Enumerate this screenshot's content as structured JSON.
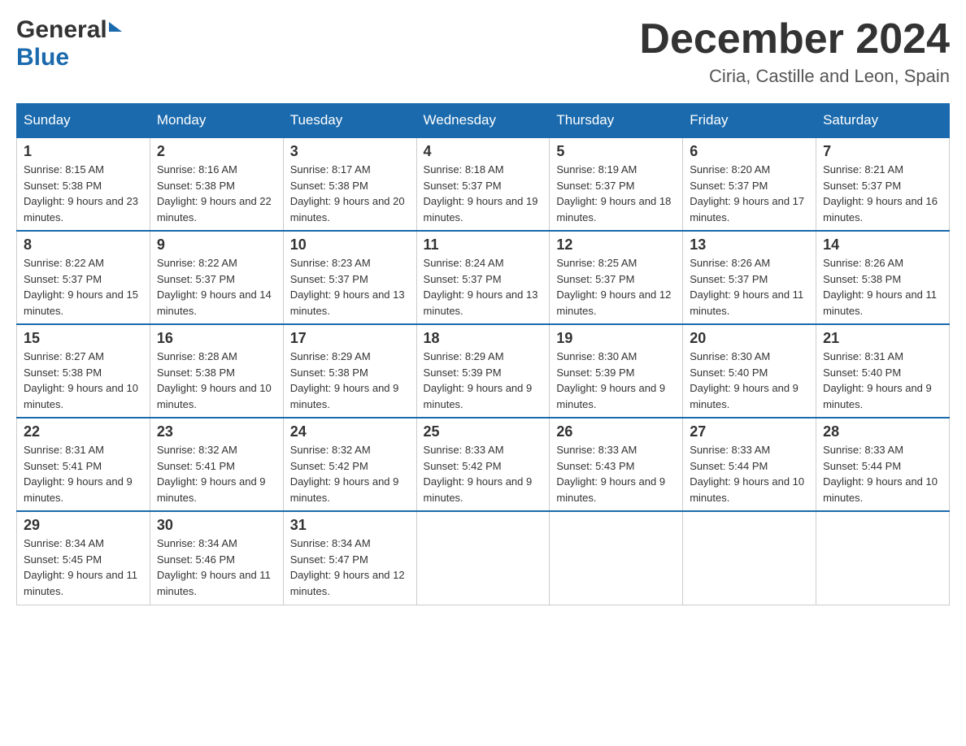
{
  "header": {
    "logo_general": "General",
    "logo_blue": "Blue",
    "month_title": "December 2024",
    "location": "Ciria, Castille and Leon, Spain"
  },
  "days_of_week": [
    "Sunday",
    "Monday",
    "Tuesday",
    "Wednesday",
    "Thursday",
    "Friday",
    "Saturday"
  ],
  "weeks": [
    [
      {
        "day": "1",
        "sunrise": "Sunrise: 8:15 AM",
        "sunset": "Sunset: 5:38 PM",
        "daylight": "Daylight: 9 hours and 23 minutes."
      },
      {
        "day": "2",
        "sunrise": "Sunrise: 8:16 AM",
        "sunset": "Sunset: 5:38 PM",
        "daylight": "Daylight: 9 hours and 22 minutes."
      },
      {
        "day": "3",
        "sunrise": "Sunrise: 8:17 AM",
        "sunset": "Sunset: 5:38 PM",
        "daylight": "Daylight: 9 hours and 20 minutes."
      },
      {
        "day": "4",
        "sunrise": "Sunrise: 8:18 AM",
        "sunset": "Sunset: 5:37 PM",
        "daylight": "Daylight: 9 hours and 19 minutes."
      },
      {
        "day": "5",
        "sunrise": "Sunrise: 8:19 AM",
        "sunset": "Sunset: 5:37 PM",
        "daylight": "Daylight: 9 hours and 18 minutes."
      },
      {
        "day": "6",
        "sunrise": "Sunrise: 8:20 AM",
        "sunset": "Sunset: 5:37 PM",
        "daylight": "Daylight: 9 hours and 17 minutes."
      },
      {
        "day": "7",
        "sunrise": "Sunrise: 8:21 AM",
        "sunset": "Sunset: 5:37 PM",
        "daylight": "Daylight: 9 hours and 16 minutes."
      }
    ],
    [
      {
        "day": "8",
        "sunrise": "Sunrise: 8:22 AM",
        "sunset": "Sunset: 5:37 PM",
        "daylight": "Daylight: 9 hours and 15 minutes."
      },
      {
        "day": "9",
        "sunrise": "Sunrise: 8:22 AM",
        "sunset": "Sunset: 5:37 PM",
        "daylight": "Daylight: 9 hours and 14 minutes."
      },
      {
        "day": "10",
        "sunrise": "Sunrise: 8:23 AM",
        "sunset": "Sunset: 5:37 PM",
        "daylight": "Daylight: 9 hours and 13 minutes."
      },
      {
        "day": "11",
        "sunrise": "Sunrise: 8:24 AM",
        "sunset": "Sunset: 5:37 PM",
        "daylight": "Daylight: 9 hours and 13 minutes."
      },
      {
        "day": "12",
        "sunrise": "Sunrise: 8:25 AM",
        "sunset": "Sunset: 5:37 PM",
        "daylight": "Daylight: 9 hours and 12 minutes."
      },
      {
        "day": "13",
        "sunrise": "Sunrise: 8:26 AM",
        "sunset": "Sunset: 5:37 PM",
        "daylight": "Daylight: 9 hours and 11 minutes."
      },
      {
        "day": "14",
        "sunrise": "Sunrise: 8:26 AM",
        "sunset": "Sunset: 5:38 PM",
        "daylight": "Daylight: 9 hours and 11 minutes."
      }
    ],
    [
      {
        "day": "15",
        "sunrise": "Sunrise: 8:27 AM",
        "sunset": "Sunset: 5:38 PM",
        "daylight": "Daylight: 9 hours and 10 minutes."
      },
      {
        "day": "16",
        "sunrise": "Sunrise: 8:28 AM",
        "sunset": "Sunset: 5:38 PM",
        "daylight": "Daylight: 9 hours and 10 minutes."
      },
      {
        "day": "17",
        "sunrise": "Sunrise: 8:29 AM",
        "sunset": "Sunset: 5:38 PM",
        "daylight": "Daylight: 9 hours and 9 minutes."
      },
      {
        "day": "18",
        "sunrise": "Sunrise: 8:29 AM",
        "sunset": "Sunset: 5:39 PM",
        "daylight": "Daylight: 9 hours and 9 minutes."
      },
      {
        "day": "19",
        "sunrise": "Sunrise: 8:30 AM",
        "sunset": "Sunset: 5:39 PM",
        "daylight": "Daylight: 9 hours and 9 minutes."
      },
      {
        "day": "20",
        "sunrise": "Sunrise: 8:30 AM",
        "sunset": "Sunset: 5:40 PM",
        "daylight": "Daylight: 9 hours and 9 minutes."
      },
      {
        "day": "21",
        "sunrise": "Sunrise: 8:31 AM",
        "sunset": "Sunset: 5:40 PM",
        "daylight": "Daylight: 9 hours and 9 minutes."
      }
    ],
    [
      {
        "day": "22",
        "sunrise": "Sunrise: 8:31 AM",
        "sunset": "Sunset: 5:41 PM",
        "daylight": "Daylight: 9 hours and 9 minutes."
      },
      {
        "day": "23",
        "sunrise": "Sunrise: 8:32 AM",
        "sunset": "Sunset: 5:41 PM",
        "daylight": "Daylight: 9 hours and 9 minutes."
      },
      {
        "day": "24",
        "sunrise": "Sunrise: 8:32 AM",
        "sunset": "Sunset: 5:42 PM",
        "daylight": "Daylight: 9 hours and 9 minutes."
      },
      {
        "day": "25",
        "sunrise": "Sunrise: 8:33 AM",
        "sunset": "Sunset: 5:42 PM",
        "daylight": "Daylight: 9 hours and 9 minutes."
      },
      {
        "day": "26",
        "sunrise": "Sunrise: 8:33 AM",
        "sunset": "Sunset: 5:43 PM",
        "daylight": "Daylight: 9 hours and 9 minutes."
      },
      {
        "day": "27",
        "sunrise": "Sunrise: 8:33 AM",
        "sunset": "Sunset: 5:44 PM",
        "daylight": "Daylight: 9 hours and 10 minutes."
      },
      {
        "day": "28",
        "sunrise": "Sunrise: 8:33 AM",
        "sunset": "Sunset: 5:44 PM",
        "daylight": "Daylight: 9 hours and 10 minutes."
      }
    ],
    [
      {
        "day": "29",
        "sunrise": "Sunrise: 8:34 AM",
        "sunset": "Sunset: 5:45 PM",
        "daylight": "Daylight: 9 hours and 11 minutes."
      },
      {
        "day": "30",
        "sunrise": "Sunrise: 8:34 AM",
        "sunset": "Sunset: 5:46 PM",
        "daylight": "Daylight: 9 hours and 11 minutes."
      },
      {
        "day": "31",
        "sunrise": "Sunrise: 8:34 AM",
        "sunset": "Sunset: 5:47 PM",
        "daylight": "Daylight: 9 hours and 12 minutes."
      },
      null,
      null,
      null,
      null
    ]
  ],
  "colors": {
    "header_bg": "#1a6aad",
    "border": "#1a6aad",
    "logo_dark": "#333",
    "logo_blue": "#1a6aad"
  }
}
